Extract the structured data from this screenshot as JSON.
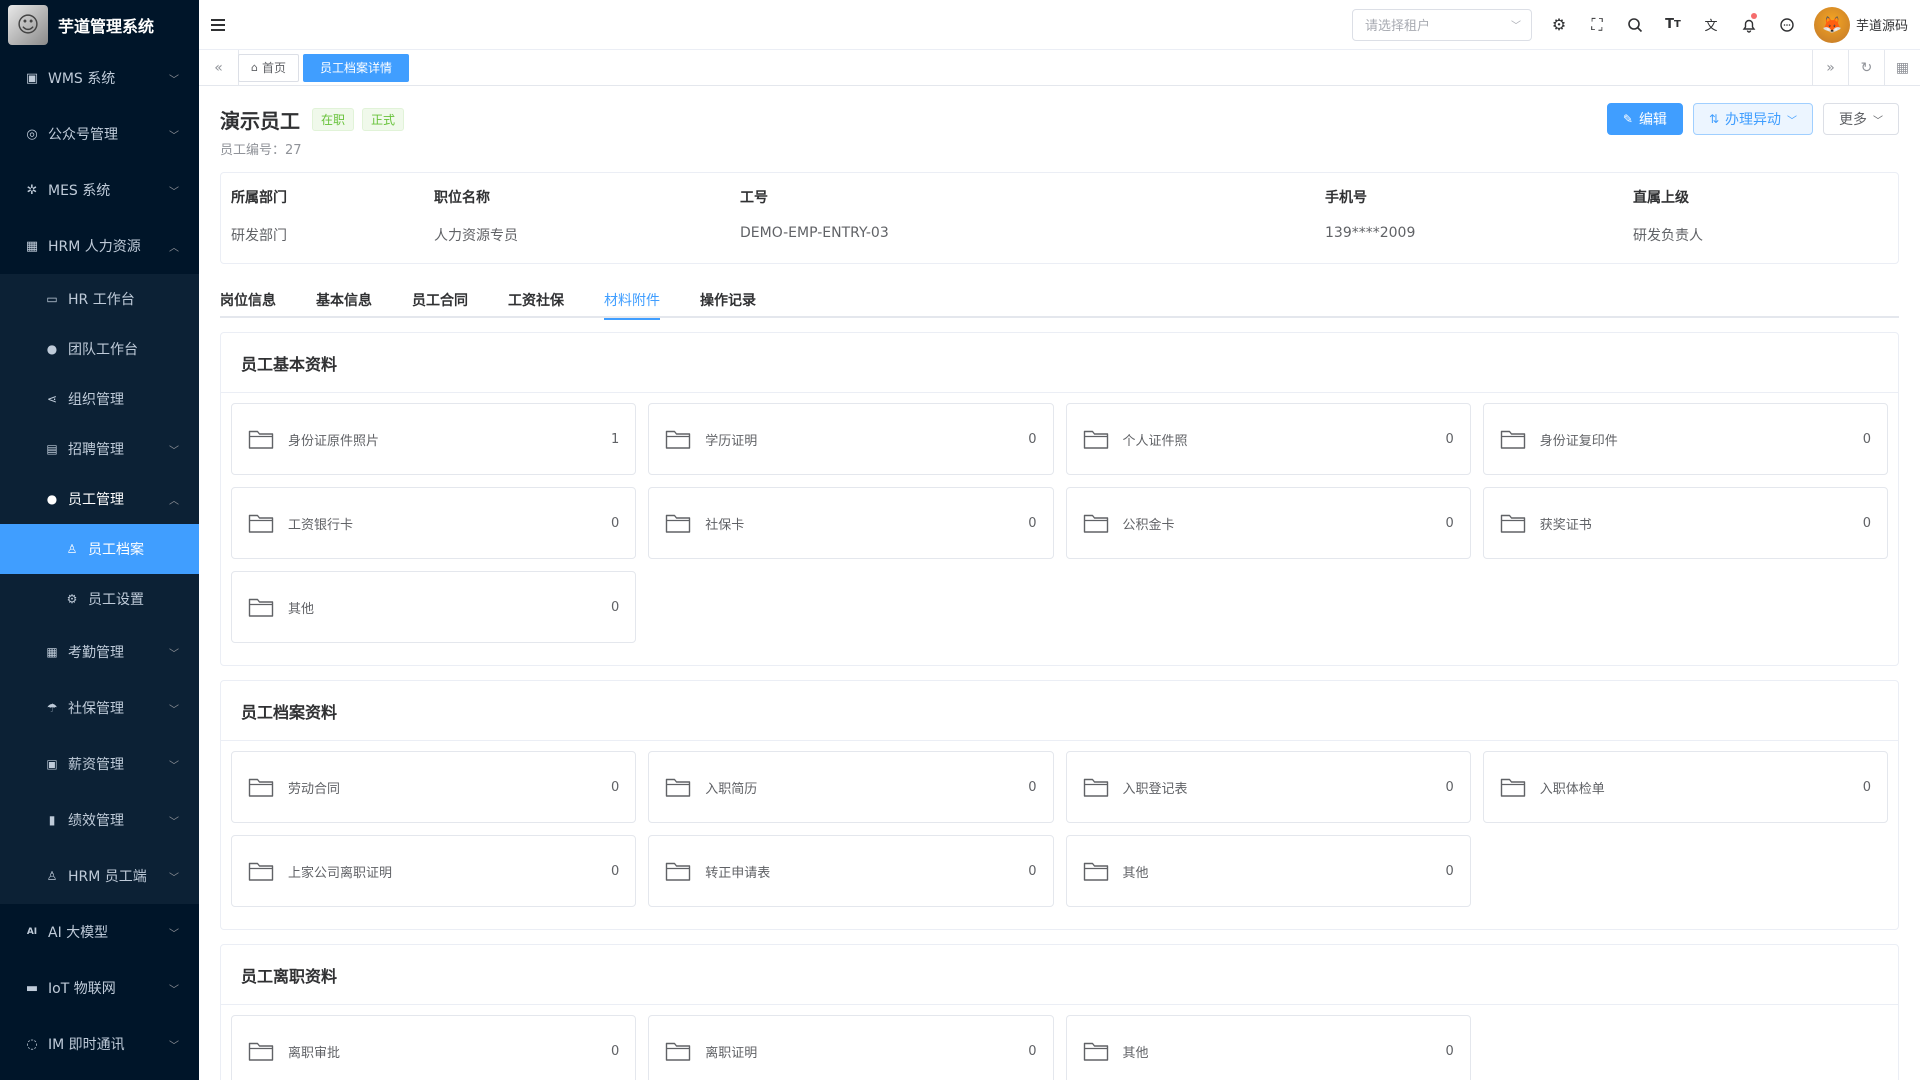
{
  "app": {
    "title": "芋道管理系统"
  },
  "sidebar": {
    "menus": [
      {
        "label": "WMS 系统",
        "icon": "box-icon"
      },
      {
        "label": "公众号管理",
        "icon": "compass-icon"
      },
      {
        "label": "MES 系统",
        "icon": "chip-icon"
      },
      {
        "label": "HRM 人力资源",
        "icon": "building-icon"
      }
    ],
    "hrm_children": [
      {
        "label": "HR 工作台",
        "icon": "monitor-icon"
      },
      {
        "label": "团队工作台",
        "icon": "user-icon"
      },
      {
        "label": "组织管理",
        "icon": "share-icon"
      },
      {
        "label": "招聘管理",
        "icon": "briefcase-icon"
      },
      {
        "label": "员工管理",
        "icon": "user-icon"
      }
    ],
    "employee_children": [
      {
        "label": "员工档案",
        "icon": "user-outline-icon"
      },
      {
        "label": "员工设置",
        "icon": "gear-icon"
      }
    ],
    "hrm_children_after": [
      {
        "label": "考勤管理",
        "icon": "calendar-icon"
      },
      {
        "label": "社保管理",
        "icon": "umbrella-icon"
      },
      {
        "label": "薪资管理",
        "icon": "wallet-icon"
      },
      {
        "label": "绩效管理",
        "icon": "bar-chart-icon"
      },
      {
        "label": "HRM 员工端",
        "icon": "user-outline-icon"
      }
    ],
    "menus_after": [
      {
        "label": "AI 大模型",
        "icon": "ai-icon"
      },
      {
        "label": "IoT 物联网",
        "icon": "router-icon"
      },
      {
        "label": "IM 即时通讯",
        "icon": "chat-icon"
      }
    ]
  },
  "header": {
    "tenant_placeholder": "请选择租户",
    "user_name": "芋道源码"
  },
  "tags": {
    "home": "首页",
    "current": "员工档案详情"
  },
  "employee": {
    "name": "演示员工",
    "status": "在职",
    "type": "正式",
    "no_label": "员工编号：",
    "no_value": "27",
    "actions": {
      "edit": "编辑",
      "change": "办理异动",
      "more": "更多"
    }
  },
  "info": {
    "dept_label": "所属部门",
    "dept_value": "研发部门",
    "post_label": "职位名称",
    "post_value": "人力资源专员",
    "code_label": "工号",
    "code_value": "DEMO-EMP-ENTRY-03",
    "mobile_label": "手机号",
    "mobile_value": "139****2009",
    "leader_label": "直属上级",
    "leader_value": "研发负责人"
  },
  "tabs": [
    "岗位信息",
    "基本信息",
    "员工合同",
    "工资社保",
    "材料附件",
    "操作记录"
  ],
  "sections": [
    {
      "title": "员工基本资料",
      "files": [
        {
          "name": "身份证原件照片",
          "count": "1"
        },
        {
          "name": "学历证明",
          "count": "0"
        },
        {
          "name": "个人证件照",
          "count": "0"
        },
        {
          "name": "身份证复印件",
          "count": "0"
        },
        {
          "name": "工资银行卡",
          "count": "0"
        },
        {
          "name": "社保卡",
          "count": "0"
        },
        {
          "name": "公积金卡",
          "count": "0"
        },
        {
          "name": "获奖证书",
          "count": "0"
        },
        {
          "name": "其他",
          "count": "0"
        }
      ]
    },
    {
      "title": "员工档案资料",
      "files": [
        {
          "name": "劳动合同",
          "count": "0"
        },
        {
          "name": "入职简历",
          "count": "0"
        },
        {
          "name": "入职登记表",
          "count": "0"
        },
        {
          "name": "入职体检单",
          "count": "0"
        },
        {
          "name": "上家公司离职证明",
          "count": "0"
        },
        {
          "name": "转正申请表",
          "count": "0"
        },
        {
          "name": "其他",
          "count": "0"
        }
      ]
    },
    {
      "title": "员工离职资料",
      "files": [
        {
          "name": "离职审批",
          "count": "0"
        },
        {
          "name": "离职证明",
          "count": "0"
        },
        {
          "name": "其他",
          "count": "0"
        }
      ]
    }
  ]
}
